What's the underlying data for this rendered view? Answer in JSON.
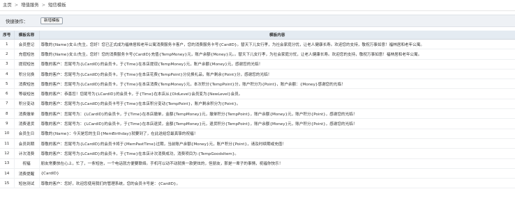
{
  "breadcrumb": {
    "home": "主页",
    "section": "增值服务",
    "page": "短信模板",
    "separator": ">"
  },
  "toolbar": {
    "label": "快捷操作：",
    "new_template_button": "新增模板"
  },
  "table": {
    "headers": {
      "no": "序号",
      "name": "模板名称",
      "content": "模板内容"
    },
    "rows": [
      {
        "no": "1",
        "name": "会员登记",
        "content": "尊敬的{Name}女士/先生，您好！您已正式成为福林居和老年公寓消费服务卡客户，您的消费服务卡号{CardID}。替天下儿女行孝，为社会家庭分忧，让老人健康长寿。欢迎您的支持，敬祝万事如意！福林居和老年公寓。"
      },
      {
        "no": "2",
        "name": "充值短信",
        "content": "尊敬的{Name}女士/先生，您好！您的消费服务卡号{CardID}充值{TempMoney}元，账户余额{Money}元。。替天下儿女行孝，为社会家庭分忧，让老人健康长寿。欢迎您的支持，敬祝万事如意！福林居和老年公寓。"
      },
      {
        "no": "3",
        "name": "提现短信",
        "content": "尊敬的客户：您尾号为{LCardID}的会员卡，于{Time}在本店提现{TempMoney}元，账户余额{Money}元，感谢您的光临！"
      },
      {
        "no": "4",
        "name": "积分兑换",
        "content": "尊敬的客户：您尾号为{LCardID}的会员卡，于{Time}在本店花费{TempPoint}分兑换礼品，账户剩余{Point}分，感谢您的光临！"
      },
      {
        "no": "5",
        "name": "消费短信",
        "content": "尊敬的客户：您尾号为{LCardID}的会员卡，于{Time}在本店消费{TempMoney}元，本次积分{TempPoint}分，账户积分为{Point}，账户余额：{Money}感谢您的光临！"
      },
      {
        "no": "6",
        "name": "等级短信",
        "content": "尊敬的客户：恭喜您！您尾号为{LCardID}的会员卡，于{Time}在本店从{OldLevel}会员变为{NewLevel}会员。"
      },
      {
        "no": "7",
        "name": "积分变动",
        "content": "尊敬的客户：您尾号为{LCardID}的会员卡号于{Time}在本店积分变动{TempPoint}，账户剩余积分为{Point}。"
      },
      {
        "no": "8",
        "name": "消费撤单",
        "content": "尊敬的客户：您尾号为：{LCardID}的会员卡，于{Time}在本店撤单，金额{TempMoney}元，撤单积分{TempPoint}，账户余额{Money}元，账户积分{Point}，感谢您的光临！"
      },
      {
        "no": "9",
        "name": "消费退货",
        "content": "尊敬的客户：您尾号为：{LCardID}的会员卡，于{Time}在本店退货，金额{TempMoney}元，退货积分{TempPoint}，账户余额{Money}元，账户积分{Point}，感谢您的光临！"
      },
      {
        "no": "10",
        "name": "会员生日",
        "content": "尊敬的{Name}：今天是您的生日{MemBirthday}就要到了，在此送给您最真挚的祝福！"
      },
      {
        "no": "11",
        "name": "会员到期",
        "content": "尊敬的客户：您尾号为{LCardID}的会员卡将于{MemPastTime}过期，当前账户余额{Money}元，账户积分{Point}，请及时续期或充值！"
      },
      {
        "no": "12",
        "name": "计次消费",
        "content": "尊敬的客户：您尾号为{LCardID}的会员卡，于{Time}在本店计次消费成功，消费项目为:{TempGoodsItem}。"
      },
      {
        "no": "13",
        "name": "祝福",
        "content": "朋友常要放在心上，忙了，一条短信，一个电话就方便要联络。手机可以动不动就换一款更炫的，但朋友，那是一辈子的事情，祝福你快乐！"
      },
      {
        "no": "14",
        "name": "消费提醒",
        "content": "{CardID}"
      },
      {
        "no": "15",
        "name": "短信测试",
        "content": "尊敬的客户：您好，欢迎您使用我们的管理系统，您的会员卡号是：{CardID}。"
      }
    ]
  }
}
